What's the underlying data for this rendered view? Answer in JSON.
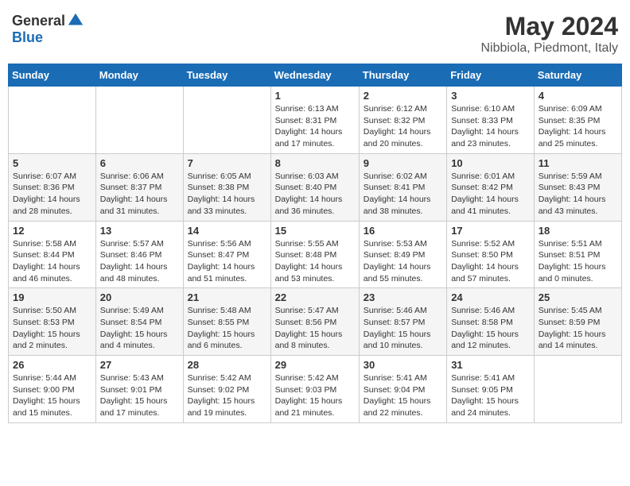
{
  "header": {
    "logo_general": "General",
    "logo_blue": "Blue",
    "month_title": "May 2024",
    "location": "Nibbiola, Piedmont, Italy"
  },
  "columns": [
    "Sunday",
    "Monday",
    "Tuesday",
    "Wednesday",
    "Thursday",
    "Friday",
    "Saturday"
  ],
  "weeks": [
    [
      {
        "day": "",
        "info": ""
      },
      {
        "day": "",
        "info": ""
      },
      {
        "day": "",
        "info": ""
      },
      {
        "day": "1",
        "info": "Sunrise: 6:13 AM\nSunset: 8:31 PM\nDaylight: 14 hours\nand 17 minutes."
      },
      {
        "day": "2",
        "info": "Sunrise: 6:12 AM\nSunset: 8:32 PM\nDaylight: 14 hours\nand 20 minutes."
      },
      {
        "day": "3",
        "info": "Sunrise: 6:10 AM\nSunset: 8:33 PM\nDaylight: 14 hours\nand 23 minutes."
      },
      {
        "day": "4",
        "info": "Sunrise: 6:09 AM\nSunset: 8:35 PM\nDaylight: 14 hours\nand 25 minutes."
      }
    ],
    [
      {
        "day": "5",
        "info": "Sunrise: 6:07 AM\nSunset: 8:36 PM\nDaylight: 14 hours\nand 28 minutes."
      },
      {
        "day": "6",
        "info": "Sunrise: 6:06 AM\nSunset: 8:37 PM\nDaylight: 14 hours\nand 31 minutes."
      },
      {
        "day": "7",
        "info": "Sunrise: 6:05 AM\nSunset: 8:38 PM\nDaylight: 14 hours\nand 33 minutes."
      },
      {
        "day": "8",
        "info": "Sunrise: 6:03 AM\nSunset: 8:40 PM\nDaylight: 14 hours\nand 36 minutes."
      },
      {
        "day": "9",
        "info": "Sunrise: 6:02 AM\nSunset: 8:41 PM\nDaylight: 14 hours\nand 38 minutes."
      },
      {
        "day": "10",
        "info": "Sunrise: 6:01 AM\nSunset: 8:42 PM\nDaylight: 14 hours\nand 41 minutes."
      },
      {
        "day": "11",
        "info": "Sunrise: 5:59 AM\nSunset: 8:43 PM\nDaylight: 14 hours\nand 43 minutes."
      }
    ],
    [
      {
        "day": "12",
        "info": "Sunrise: 5:58 AM\nSunset: 8:44 PM\nDaylight: 14 hours\nand 46 minutes."
      },
      {
        "day": "13",
        "info": "Sunrise: 5:57 AM\nSunset: 8:46 PM\nDaylight: 14 hours\nand 48 minutes."
      },
      {
        "day": "14",
        "info": "Sunrise: 5:56 AM\nSunset: 8:47 PM\nDaylight: 14 hours\nand 51 minutes."
      },
      {
        "day": "15",
        "info": "Sunrise: 5:55 AM\nSunset: 8:48 PM\nDaylight: 14 hours\nand 53 minutes."
      },
      {
        "day": "16",
        "info": "Sunrise: 5:53 AM\nSunset: 8:49 PM\nDaylight: 14 hours\nand 55 minutes."
      },
      {
        "day": "17",
        "info": "Sunrise: 5:52 AM\nSunset: 8:50 PM\nDaylight: 14 hours\nand 57 minutes."
      },
      {
        "day": "18",
        "info": "Sunrise: 5:51 AM\nSunset: 8:51 PM\nDaylight: 15 hours\nand 0 minutes."
      }
    ],
    [
      {
        "day": "19",
        "info": "Sunrise: 5:50 AM\nSunset: 8:53 PM\nDaylight: 15 hours\nand 2 minutes."
      },
      {
        "day": "20",
        "info": "Sunrise: 5:49 AM\nSunset: 8:54 PM\nDaylight: 15 hours\nand 4 minutes."
      },
      {
        "day": "21",
        "info": "Sunrise: 5:48 AM\nSunset: 8:55 PM\nDaylight: 15 hours\nand 6 minutes."
      },
      {
        "day": "22",
        "info": "Sunrise: 5:47 AM\nSunset: 8:56 PM\nDaylight: 15 hours\nand 8 minutes."
      },
      {
        "day": "23",
        "info": "Sunrise: 5:46 AM\nSunset: 8:57 PM\nDaylight: 15 hours\nand 10 minutes."
      },
      {
        "day": "24",
        "info": "Sunrise: 5:46 AM\nSunset: 8:58 PM\nDaylight: 15 hours\nand 12 minutes."
      },
      {
        "day": "25",
        "info": "Sunrise: 5:45 AM\nSunset: 8:59 PM\nDaylight: 15 hours\nand 14 minutes."
      }
    ],
    [
      {
        "day": "26",
        "info": "Sunrise: 5:44 AM\nSunset: 9:00 PM\nDaylight: 15 hours\nand 15 minutes."
      },
      {
        "day": "27",
        "info": "Sunrise: 5:43 AM\nSunset: 9:01 PM\nDaylight: 15 hours\nand 17 minutes."
      },
      {
        "day": "28",
        "info": "Sunrise: 5:42 AM\nSunset: 9:02 PM\nDaylight: 15 hours\nand 19 minutes."
      },
      {
        "day": "29",
        "info": "Sunrise: 5:42 AM\nSunset: 9:03 PM\nDaylight: 15 hours\nand 21 minutes."
      },
      {
        "day": "30",
        "info": "Sunrise: 5:41 AM\nSunset: 9:04 PM\nDaylight: 15 hours\nand 22 minutes."
      },
      {
        "day": "31",
        "info": "Sunrise: 5:41 AM\nSunset: 9:05 PM\nDaylight: 15 hours\nand 24 minutes."
      },
      {
        "day": "",
        "info": ""
      }
    ]
  ]
}
